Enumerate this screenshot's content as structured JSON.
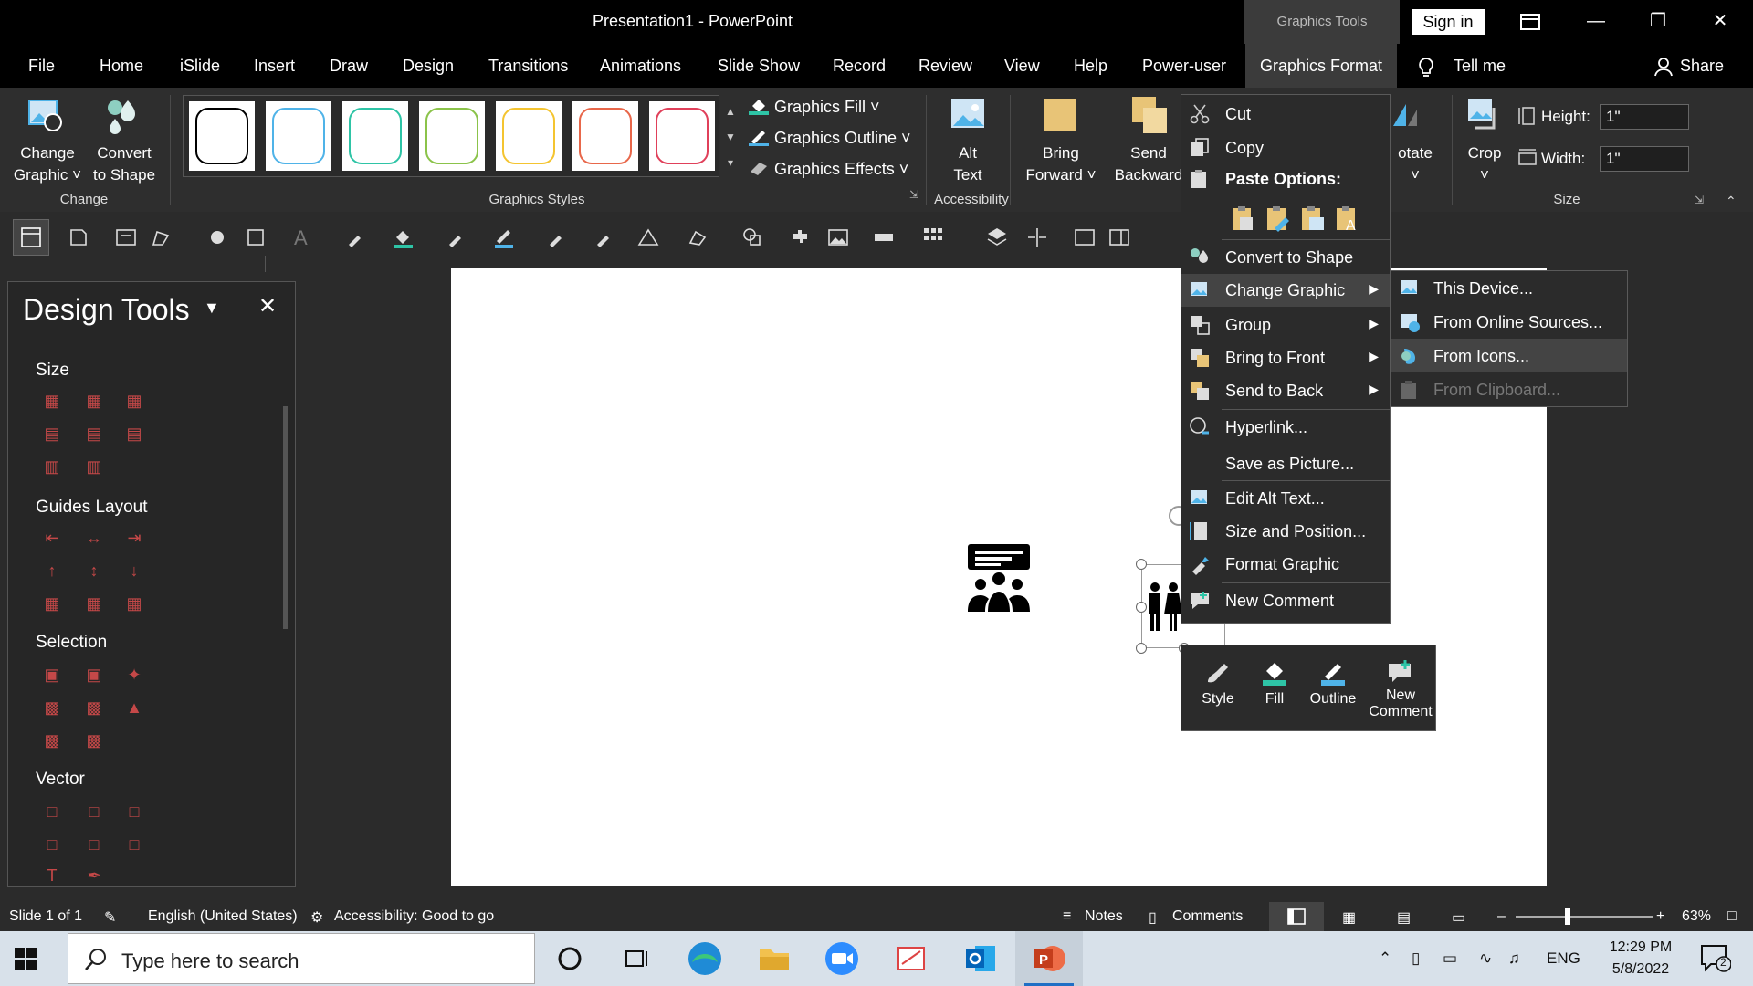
{
  "window": {
    "title": "Presentation1  -  PowerPoint",
    "contextual_tab_header": "Graphics Tools",
    "sign_in": "Sign in"
  },
  "tabs": [
    "File",
    "Home",
    "iSlide",
    "Insert",
    "Draw",
    "Design",
    "Transitions",
    "Animations",
    "Slide Show",
    "Record",
    "Review",
    "View",
    "Help",
    "Power-user",
    "Graphics Format",
    "Tell me",
    "Share"
  ],
  "ribbon": {
    "change_graphic": [
      "Change",
      "Graphic ˅"
    ],
    "convert_to_shape": [
      "Convert",
      "to Shape"
    ],
    "group_change": "Change",
    "group_graphics_styles": "Graphics Styles",
    "style_colors": [
      "#000000",
      "#4fb3e8",
      "#2ec4a6",
      "#8bc34a",
      "#f4c430",
      "#e8674a",
      "#e0405a"
    ],
    "graphics_fill": "Graphics Fill ˅",
    "graphics_outline": "Graphics Outline ˅",
    "graphics_effects": "Graphics Effects ˅",
    "alt_text": [
      "Alt",
      "Text"
    ],
    "group_accessibility": "Accessibility",
    "bring_forward": [
      "Bring",
      "Forward ˅"
    ],
    "send_backward": [
      "Send",
      "Backward"
    ],
    "rotate": [
      "otate",
      "˅"
    ],
    "crop": [
      "Crop",
      "˅"
    ],
    "height_label": "Height:",
    "height_value": "1\"",
    "width_label": "Width:",
    "width_value": "1\"",
    "group_size": "Size"
  },
  "design_tools": {
    "title": "Design Tools",
    "sections": [
      "Size",
      "Guides Layout",
      "Selection",
      "Vector"
    ]
  },
  "context_menu": {
    "items": [
      {
        "label": "Cut",
        "icon": "scissors-icon"
      },
      {
        "label": "Copy",
        "icon": "copy-icon"
      },
      {
        "label": "Paste Options:",
        "icon": "paste-icon"
      },
      {
        "label": "Convert to Shape",
        "icon": "convert-shape-icon"
      },
      {
        "label": "Change Graphic",
        "icon": "change-graphic-icon"
      },
      {
        "label": "Group",
        "icon": "group-icon"
      },
      {
        "label": "Bring to Front",
        "icon": "bring-front-icon"
      },
      {
        "label": "Send to Back",
        "icon": "send-back-icon"
      },
      {
        "label": "Hyperlink...",
        "icon": "hyperlink-icon"
      },
      {
        "label": "Save as Picture...",
        "icon": ""
      },
      {
        "label": "Edit Alt Text...",
        "icon": "alt-text-icon"
      },
      {
        "label": "Size and Position...",
        "icon": "size-position-icon"
      },
      {
        "label": "Format Graphic",
        "icon": "format-graphic-icon"
      },
      {
        "label": "New Comment",
        "icon": "comment-icon"
      }
    ]
  },
  "submenu": {
    "items": [
      {
        "label": "This Device...",
        "enabled": true
      },
      {
        "label": "From Online Sources...",
        "enabled": true
      },
      {
        "label": "From Icons...",
        "enabled": true
      },
      {
        "label": "From Clipboard...",
        "enabled": false
      }
    ]
  },
  "mini_toolbar": {
    "style": "Style",
    "fill": "Fill",
    "outline": "Outline",
    "new_comment": [
      "New",
      "Comment"
    ]
  },
  "status_bar": {
    "slide": "Slide 1 of 1",
    "language": "English (United States)",
    "accessibility": "Accessibility: Good to go",
    "notes": "Notes",
    "comments": "Comments",
    "zoom": "63%"
  },
  "taskbar": {
    "search_placeholder": "Type here to search",
    "lang": "ENG",
    "time": "12:29 PM",
    "date": "5/8/2022",
    "notif_count": "2"
  },
  "colors": {
    "accent_teal": "#2ec4a6",
    "accent_blue": "#4fb3e8",
    "panel_red_icons": "#c54848"
  }
}
